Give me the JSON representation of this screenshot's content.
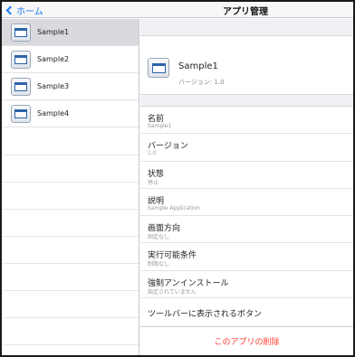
{
  "nav": {
    "back_label": "ホーム",
    "title": "アプリ管理"
  },
  "apps": [
    {
      "name": "Sample1",
      "selected": true
    },
    {
      "name": "Sample2",
      "selected": false
    },
    {
      "name": "Sample3",
      "selected": false
    },
    {
      "name": "Sample4",
      "selected": false
    }
  ],
  "detail": {
    "name": "Sample1",
    "version_line": "バージョン: 1.0",
    "properties": [
      {
        "label": "名前",
        "value": "Sample1"
      },
      {
        "label": "バージョン",
        "value": "1.0"
      },
      {
        "label": "状態",
        "value": "停止"
      },
      {
        "label": "説明",
        "value": "Sample Application"
      },
      {
        "label": "画面方向",
        "value": "固定なし"
      },
      {
        "label": "実行可能条件",
        "value": "制限なし"
      },
      {
        "label": "強制アンインストール",
        "value": "指定されていません"
      },
      {
        "label": "ツールバーに表示されるボタン",
        "value": ""
      }
    ],
    "delete_label": "このアプリの削除"
  },
  "colors": {
    "accent": "#1a7cf5",
    "danger": "#ff3b30",
    "selected_row": "#d9d9de",
    "grouped_bg": "#efeff4"
  }
}
